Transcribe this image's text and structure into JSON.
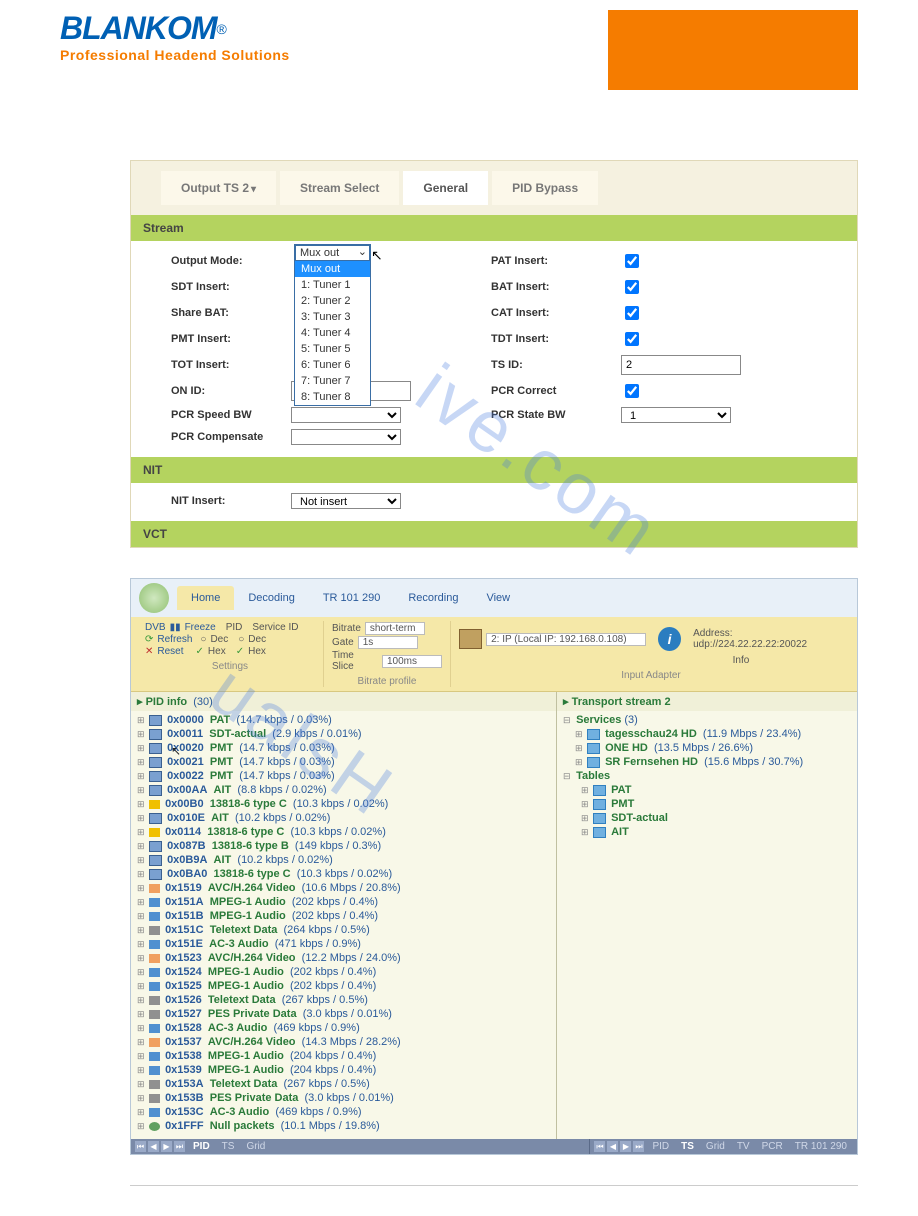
{
  "logo": {
    "brand": "BLANKOM",
    "reg": "®",
    "tagline": "Professional Headend Solutions"
  },
  "watermark": "ualsHive.com",
  "panel1": {
    "tabs": {
      "t1": "Output TS 2",
      "t2": "Stream Select",
      "t3": "General",
      "t4": "PID Bypass"
    },
    "sections": {
      "stream": "Stream",
      "nit": "NIT",
      "vct": "VCT"
    },
    "labels": {
      "output_mode": "Output Mode:",
      "sdt_insert": "SDT Insert:",
      "share_bat": "Share BAT:",
      "pmt_insert": "PMT Insert:",
      "tot_insert": "TOT Insert:",
      "on_id": "ON ID:",
      "pcr_speed_bw": "PCR Speed BW",
      "pcr_compensate": "PCR Compensate",
      "pat_insert": "PAT Insert:",
      "bat_insert": "BAT Insert:",
      "cat_insert": "CAT Insert:",
      "tdt_insert": "TDT Insert:",
      "ts_id": "TS ID:",
      "pcr_correct": "PCR Correct",
      "pcr_state_bw": "PCR State BW",
      "nit_insert": "NIT Insert:"
    },
    "values": {
      "ts_id": "2",
      "pcr_state_bw": "1",
      "nit_insert": "Not insert"
    },
    "dropdown": {
      "selected": "Mux out",
      "items": [
        "Mux out",
        "1: Tuner 1",
        "2: Tuner 2",
        "3: Tuner 3",
        "4: Tuner 4",
        "5: Tuner 5",
        "6: Tuner 6",
        "7: Tuner 7",
        "8: Tuner 8"
      ]
    }
  },
  "panel2": {
    "tabs": {
      "home": "Home",
      "decoding": "Decoding",
      "tr": "TR 101 290",
      "rec": "Recording",
      "view": "View"
    },
    "ribbon": {
      "dvb": "DVB",
      "freeze": "Freeze",
      "refresh": "Refresh",
      "reset": "Reset",
      "pid": "PID",
      "dec": "Dec",
      "hex": "Hex",
      "svcid": "Service ID",
      "bitrate": "Bitrate",
      "gate": "Gate",
      "timeslice": "Time Slice",
      "bitrate_v": "short-term",
      "gate_v": "1s",
      "timeslice_v": "100ms",
      "input": "2: IP (Local IP: 192.168.0.108)",
      "info": "Info",
      "address": "Address: udp://224.22.22.22:20022",
      "grp_settings": "Settings",
      "grp_bitrate": "Bitrate profile",
      "grp_input": "Input Adapter"
    },
    "left": {
      "header": "PID info",
      "count": "(30)",
      "rows": [
        {
          "pid": "0x0000",
          "type": "PAT",
          "stats": "(14.7 kbps / 0.03%)",
          "ic": "default"
        },
        {
          "pid": "0x0011",
          "type": "SDT-actual",
          "stats": "(2.9 kbps / 0.01%)",
          "ic": "default"
        },
        {
          "pid": "0x0020",
          "type": "PMT",
          "stats": "(14.7 kbps / 0.03%)",
          "ic": "default"
        },
        {
          "pid": "0x0021",
          "type": "PMT",
          "stats": "(14.7 kbps / 0.03%)",
          "ic": "default"
        },
        {
          "pid": "0x0022",
          "type": "PMT",
          "stats": "(14.7 kbps / 0.03%)",
          "ic": "default"
        },
        {
          "pid": "0x00AA",
          "type": "AIT",
          "stats": "(8.8 kbps / 0.02%)",
          "ic": "default"
        },
        {
          "pid": "0x00B0",
          "type": "13818-6 type C",
          "stats": "(10.3 kbps / 0.02%)",
          "ic": "bolt"
        },
        {
          "pid": "0x010E",
          "type": "AIT",
          "stats": "(10.2 kbps / 0.02%)",
          "ic": "default"
        },
        {
          "pid": "0x0114",
          "type": "13818-6 type C",
          "stats": "(10.3 kbps / 0.02%)",
          "ic": "bolt"
        },
        {
          "pid": "0x087B",
          "type": "13818-6 type B",
          "stats": "(149 kbps / 0.3%)",
          "ic": "default"
        },
        {
          "pid": "0x0B9A",
          "type": "AIT",
          "stats": "(10.2 kbps / 0.02%)",
          "ic": "default"
        },
        {
          "pid": "0x0BA0",
          "type": "13818-6 type C",
          "stats": "(10.3 kbps / 0.02%)",
          "ic": "default"
        },
        {
          "pid": "0x1519",
          "type": "AVC/H.264 Video",
          "stats": "(10.6 Mbps / 20.8%)",
          "ic": "vid"
        },
        {
          "pid": "0x151A",
          "type": "MPEG-1 Audio",
          "stats": "(202 kbps / 0.4%)",
          "ic": "aud"
        },
        {
          "pid": "0x151B",
          "type": "MPEG-1 Audio",
          "stats": "(202 kbps / 0.4%)",
          "ic": "aud"
        },
        {
          "pid": "0x151C",
          "type": "Teletext Data",
          "stats": "(264 kbps / 0.5%)",
          "ic": "txt"
        },
        {
          "pid": "0x151E",
          "type": "AC-3 Audio",
          "stats": "(471 kbps / 0.9%)",
          "ic": "aud"
        },
        {
          "pid": "0x1523",
          "type": "AVC/H.264 Video",
          "stats": "(12.2 Mbps / 24.0%)",
          "ic": "vid"
        },
        {
          "pid": "0x1524",
          "type": "MPEG-1 Audio",
          "stats": "(202 kbps / 0.4%)",
          "ic": "aud"
        },
        {
          "pid": "0x1525",
          "type": "MPEG-1 Audio",
          "stats": "(202 kbps / 0.4%)",
          "ic": "aud"
        },
        {
          "pid": "0x1526",
          "type": "Teletext Data",
          "stats": "(267 kbps / 0.5%)",
          "ic": "txt"
        },
        {
          "pid": "0x1527",
          "type": "PES Private Data",
          "stats": "(3.0 kbps / 0.01%)",
          "ic": "txt"
        },
        {
          "pid": "0x1528",
          "type": "AC-3 Audio",
          "stats": "(469 kbps / 0.9%)",
          "ic": "aud"
        },
        {
          "pid": "0x1537",
          "type": "AVC/H.264 Video",
          "stats": "(14.3 Mbps / 28.2%)",
          "ic": "vid"
        },
        {
          "pid": "0x1538",
          "type": "MPEG-1 Audio",
          "stats": "(204 kbps / 0.4%)",
          "ic": "aud"
        },
        {
          "pid": "0x1539",
          "type": "MPEG-1 Audio",
          "stats": "(204 kbps / 0.4%)",
          "ic": "aud"
        },
        {
          "pid": "0x153A",
          "type": "Teletext Data",
          "stats": "(267 kbps / 0.5%)",
          "ic": "txt"
        },
        {
          "pid": "0x153B",
          "type": "PES Private Data",
          "stats": "(3.0 kbps / 0.01%)",
          "ic": "txt"
        },
        {
          "pid": "0x153C",
          "type": "AC-3 Audio",
          "stats": "(469 kbps / 0.9%)",
          "ic": "aud"
        },
        {
          "pid": "0x1FFF",
          "type": "Null packets",
          "stats": "(10.1 Mbps / 19.8%)",
          "ic": "null"
        }
      ]
    },
    "right": {
      "ts_header": "Transport stream   2",
      "services_label": "Services",
      "services_count": "(3)",
      "services": [
        {
          "name": "tagesschau24 HD",
          "stats": "(11.9 Mbps / 23.4%)"
        },
        {
          "name": "ONE HD",
          "stats": "(13.5 Mbps / 26.6%)"
        },
        {
          "name": "SR Fernsehen HD",
          "stats": "(15.6 Mbps / 30.7%)"
        }
      ],
      "tables_label": "Tables",
      "tables": [
        "PAT",
        "PMT",
        "SDT-actual",
        "AIT"
      ]
    },
    "footer": {
      "left": [
        "PID",
        "TS",
        "Grid"
      ],
      "right": [
        "PID",
        "TS",
        "Grid",
        "TV",
        "PCR",
        "TR 101 290"
      ],
      "left_active": 0,
      "right_active": 1
    }
  }
}
